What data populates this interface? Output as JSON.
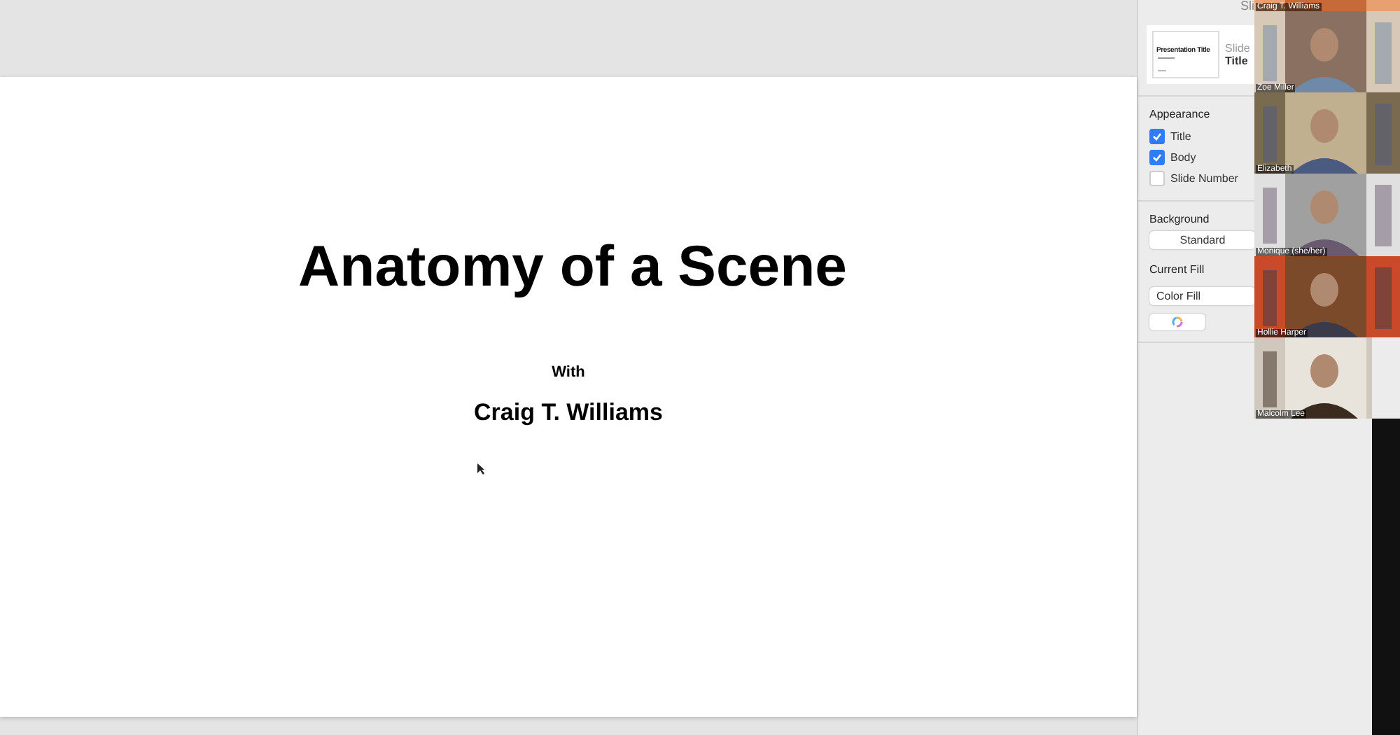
{
  "slide": {
    "title": "Anatomy of a Scene",
    "with_label": "With",
    "presenter": "Craig T. Williams"
  },
  "inspector": {
    "header": "Sli",
    "thumbnail_title": "Presentation Title",
    "layout_label": "Slide",
    "layout_name": "Title",
    "appearance_heading": "Appearance",
    "appearance": [
      {
        "label": "Title",
        "checked": true
      },
      {
        "label": "Body",
        "checked": true
      },
      {
        "label": "Slide Number",
        "checked": false
      }
    ],
    "background_heading": "Background",
    "background_button": "Standard",
    "fill_heading": "Current Fill",
    "fill_select": "Color Fill"
  },
  "participants": [
    {
      "name": "Craig T. Williams"
    },
    {
      "name": "Zoe Miller"
    },
    {
      "name": "Elizabeth"
    },
    {
      "name": "Monique (she/her)"
    },
    {
      "name": "Hollie Harper"
    },
    {
      "name": "Malcolm Lee"
    }
  ]
}
